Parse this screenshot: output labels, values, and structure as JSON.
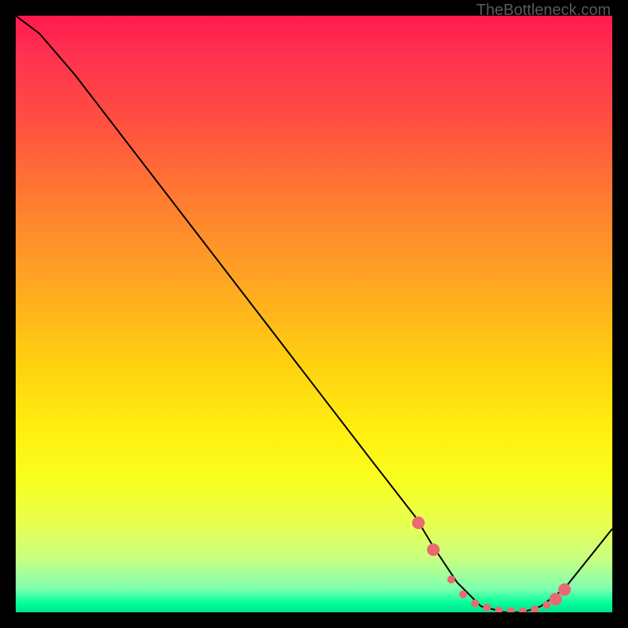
{
  "watermark": "TheBottleneck.com",
  "chart_data": {
    "type": "line",
    "title": "",
    "xlabel": "",
    "ylabel": "",
    "xlim": [
      0,
      100
    ],
    "ylim": [
      0,
      100
    ],
    "series": [
      {
        "name": "bottleneck-curve",
        "x": [
          0,
          4,
          10,
          20,
          30,
          40,
          50,
          60,
          67,
          70,
          74,
          78,
          82,
          85,
          88,
          92,
          100
        ],
        "y": [
          100,
          97,
          90,
          77,
          64,
          51,
          38,
          25,
          16,
          11,
          5,
          1,
          0,
          0,
          1,
          4,
          14
        ]
      }
    ],
    "markers": {
      "name": "highlight-points",
      "x": [
        67.5,
        70,
        73,
        75,
        77,
        79,
        81,
        83,
        85,
        87,
        89,
        90.5,
        92
      ],
      "y": [
        15,
        10.5,
        5.5,
        3,
        1.5,
        0.8,
        0.3,
        0.2,
        0.2,
        0.5,
        1.2,
        2.2,
        3.8
      ],
      "color": "#e86a72",
      "size_small": 5,
      "size_large": 8
    },
    "background_gradient": {
      "top": "#ff1a4d",
      "mid": "#fff010",
      "bottom": "#00e090"
    }
  }
}
